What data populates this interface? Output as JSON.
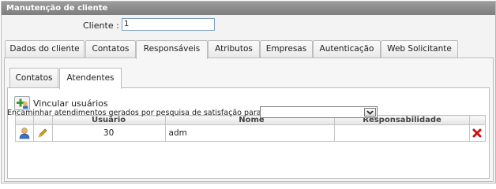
{
  "window": {
    "title": "Manutenção de cliente"
  },
  "cliente": {
    "label": "Cliente :",
    "value": "1"
  },
  "tabs": [
    {
      "label": "Dados do cliente",
      "active": false
    },
    {
      "label": "Contatos",
      "active": false
    },
    {
      "label": "Responsáveis",
      "active": true
    },
    {
      "label": "Atributos",
      "active": false
    },
    {
      "label": "Empresas",
      "active": false
    },
    {
      "label": "Autenticação",
      "active": false
    },
    {
      "label": "Web Solicitante",
      "active": false
    }
  ],
  "subtabs": [
    {
      "label": "Contatos",
      "active": false
    },
    {
      "label": "Atendentes",
      "active": true
    }
  ],
  "vincular": {
    "label": "Vincular usuários",
    "icon": "add-user-icon"
  },
  "table": {
    "headers": [
      "Usuário",
      "Nome",
      "Responsabilidade"
    ],
    "rows": [
      {
        "usuario": "30",
        "nome": "adm",
        "responsabilidade": ""
      }
    ]
  },
  "encaminhar": {
    "label": "Encaminhar atendimentos gerados por pesquisa de satisfação para :",
    "selected": ""
  },
  "colors": {
    "titlebar": "#8a8a8a",
    "delete": "#cc1111",
    "edit": "#e0a020"
  }
}
